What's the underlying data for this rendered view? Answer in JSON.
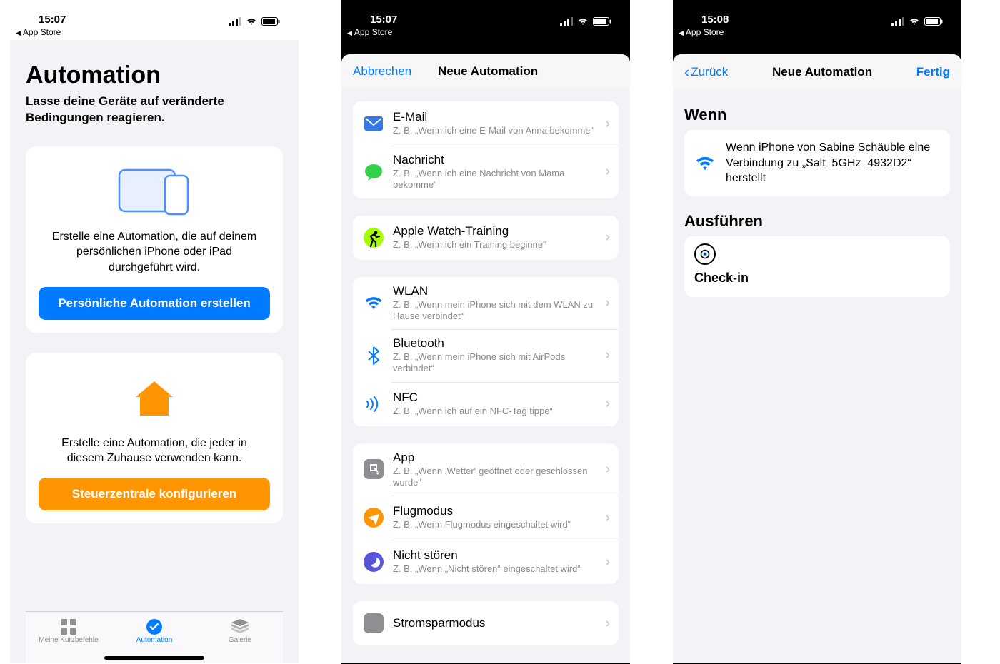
{
  "statusbar": {
    "time_a": "15:07",
    "time_b": "15:07",
    "time_c": "15:08",
    "back": "App Store"
  },
  "s1": {
    "title": "Automation",
    "subtitle": "Lasse deine Geräte auf veränderte Bedingungen reagieren.",
    "card1_text": "Erstelle eine Automation, die auf deinem persönlichen iPhone oder iPad durchgeführt wird.",
    "card1_btn": "Persönliche Automation erstellen",
    "card2_text": "Erstelle eine Automation, die jeder in diesem Zuhause verwenden kann.",
    "card2_btn": "Steuerzentrale konfigurieren",
    "tabs": {
      "shortcuts": "Meine Kurzbefehle",
      "automation": "Automation",
      "gallery": "Galerie"
    }
  },
  "s2": {
    "cancel": "Abbrechen",
    "title": "Neue Automation",
    "groups": [
      [
        {
          "icon": "mail",
          "title": "E-Mail",
          "sub": "Z. B. „Wenn ich eine E-Mail von Anna bekomme“"
        },
        {
          "icon": "msg",
          "title": "Nachricht",
          "sub": "Z. B. „Wenn ich eine Nachricht von Mama bekomme“"
        }
      ],
      [
        {
          "icon": "workout",
          "title": "Apple Watch-Training",
          "sub": "Z. B. „Wenn ich ein Training beginne“"
        }
      ],
      [
        {
          "icon": "wifi",
          "title": "WLAN",
          "sub": "Z. B. „Wenn mein iPhone sich mit dem WLAN zu Hause verbindet“"
        },
        {
          "icon": "bt",
          "title": "Bluetooth",
          "sub": "Z. B. „Wenn mein iPhone sich mit AirPods verbindet“"
        },
        {
          "icon": "nfc",
          "title": "NFC",
          "sub": "Z. B. „Wenn ich auf ein NFC-Tag tippe“"
        }
      ],
      [
        {
          "icon": "app",
          "title": "App",
          "sub": "Z. B. „Wenn ‚Wetter‘ geöffnet oder geschlossen wurde“"
        },
        {
          "icon": "plane",
          "title": "Flugmodus",
          "sub": "Z. B. „Wenn Flugmodus eingeschaltet wird“"
        },
        {
          "icon": "dnd",
          "title": "Nicht stören",
          "sub": "Z. B. „Wenn „Nicht stören“ eingeschaltet wird“"
        }
      ],
      [
        {
          "icon": "batt",
          "title": "Stromsparmodus",
          "sub": ""
        }
      ]
    ]
  },
  "s3": {
    "back": "Zurück",
    "title": "Neue Automation",
    "done": "Fertig",
    "when_label": "Wenn",
    "when_text": "Wenn iPhone von Sabine Schäuble eine Verbindung zu „Salt_5GHz_4932D2“ herstellt",
    "do_label": "Ausführen",
    "action": "Check-in"
  }
}
